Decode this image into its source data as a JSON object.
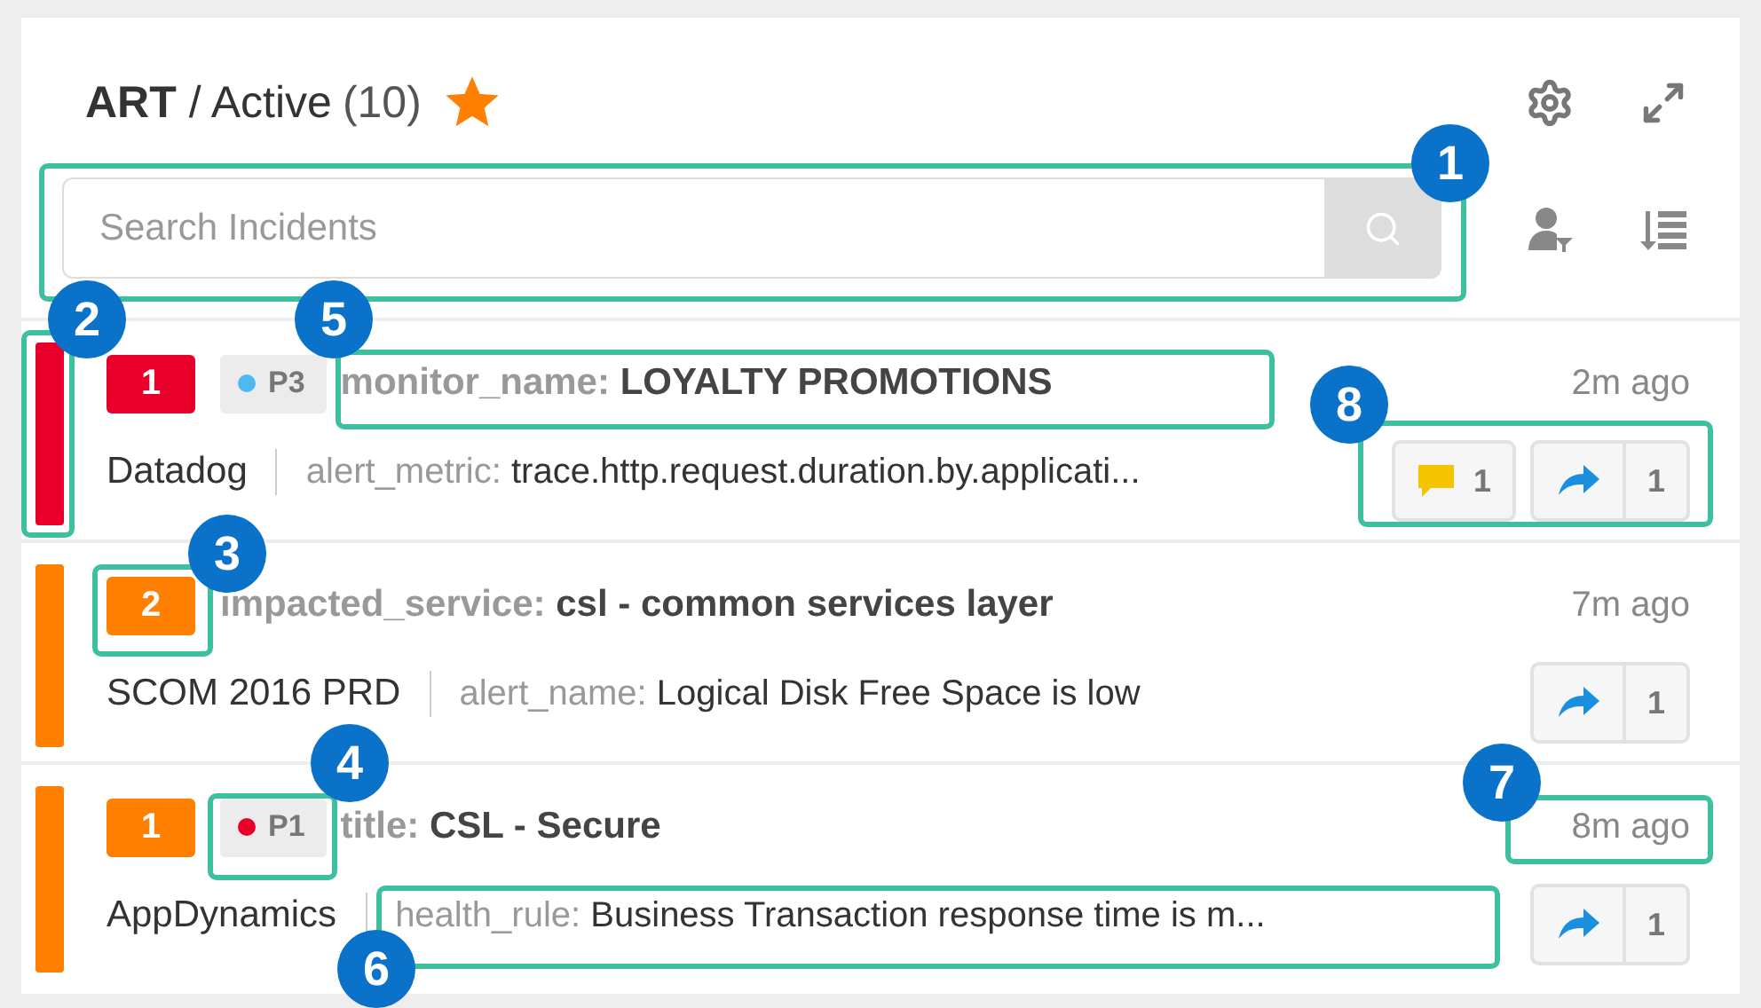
{
  "header": {
    "title_bold": "ART",
    "title_rest": "/ Active",
    "count": "(10)",
    "starred": true
  },
  "search": {
    "placeholder": "Search Incidents"
  },
  "incidents": [
    {
      "color": "#e8002a",
      "severity": {
        "label": "1",
        "color": "#e8002a"
      },
      "priority": {
        "label": "P3",
        "color": "#4fb8f0"
      },
      "title_key": "monitor_name:",
      "title_value": "LOYALTY PROMOTIONS",
      "source": "Datadog",
      "detail_key": "alert_metric:",
      "detail_value": "trace.http.request.duration.by.applicati...",
      "time": "2m ago",
      "comments": "1",
      "shares": "1"
    },
    {
      "color": "#ff7f00",
      "severity": {
        "label": "2",
        "color": "#ff7f00"
      },
      "title_key": "impacted_service:",
      "title_value": "csl - common services layer",
      "source": "SCOM 2016 PRD",
      "detail_key": "alert_name:",
      "detail_value": "Logical Disk Free Space is low",
      "time": "7m ago",
      "shares": "1"
    },
    {
      "color": "#ff7f00",
      "severity": {
        "label": "1",
        "color": "#ff7f00"
      },
      "priority": {
        "label": "P1",
        "color": "#e8002a"
      },
      "title_key": "title:",
      "title_value": "CSL - Secure",
      "source": "AppDynamics",
      "detail_key": "health_rule:",
      "detail_value": "Business Transaction response time is m...",
      "time": "8m ago",
      "shares": "1"
    }
  ],
  "callouts": [
    {
      "number": "1"
    },
    {
      "number": "2"
    },
    {
      "number": "3"
    },
    {
      "number": "4"
    },
    {
      "number": "5"
    },
    {
      "number": "6"
    },
    {
      "number": "7"
    },
    {
      "number": "8"
    }
  ]
}
